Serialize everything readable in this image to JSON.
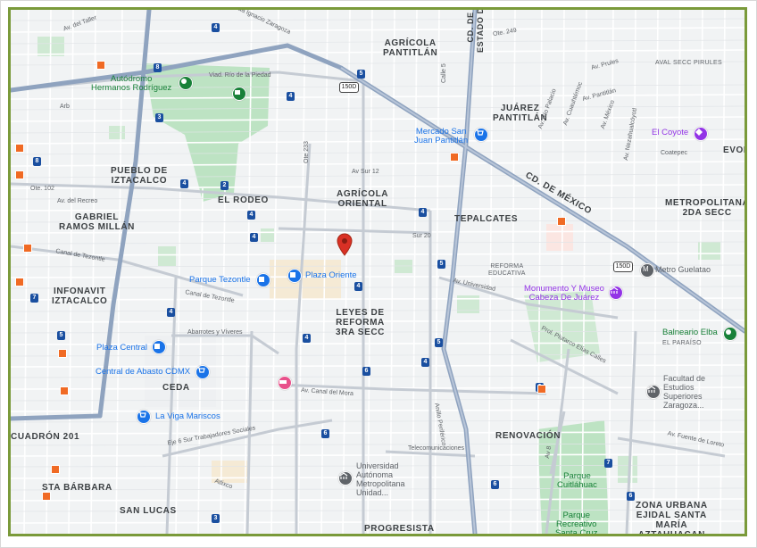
{
  "neighborhoods": {
    "agricola_pantitlan": "AGRÍCOLA\nPANTITLÁN",
    "cd_de_mexico_v": "CD. DE MÉXICO\nESTADO DE MÉXICO",
    "juarez_pantitlan": "JUÁREZ\nPANTITLÁN",
    "evol": "EVOL",
    "pueblo_iztacalco": "PUEBLO DE\nIZTACALCO",
    "el_rodeo": "EL RODEO",
    "agricola_oriental": "AGRÍCOLA\nORIENTAL",
    "tepalcates": "TEPALCATES",
    "cd_de_mexico_d": "CD. DE MÉXICO",
    "metropolitana": "METROPOLITANA\n2DA SECC",
    "gabriel": "GABRIEL\nRAMOS MILLÁN",
    "infonavit": "INFONAVIT\nIZTACALCO",
    "leyes": "LEYES DE\nREFORMA\n3RA SECC",
    "ceda": "CEDA",
    "renovacion": "RENOVACIÓN",
    "cuadron": "CUADRÓN 201",
    "sta_barbara": "STA BÁRBARA",
    "san_lucas": "SAN LUCAS",
    "progresista": "PROGRESISTA",
    "zona_urbana": "ZONA URBANA\nEJIDAL SANTA\nMARÍA\nAZTAHUACAN",
    "aval_secc": "AVAL SECC PIRULES",
    "reforma_educativa": "REFORMA\nEDUCATIVA",
    "el_paraiso": "EL PARAÍSO"
  },
  "streets": {
    "av_del_taller": "Av. del Taller",
    "calz_zaragoza": "Calzada Ignacio Zaragoza",
    "viad_rio_piedad": "Viad. Río de la Piedad",
    "av_sur_12": "Av Sur 12",
    "ote_102": "Ote. 102",
    "av_del_recreo": "Av. del Recreo",
    "canal_tezontle_1": "Canal de Tezontle",
    "canal_tezontle_2": "Canal de Tezontle",
    "sur_20": "Sur 20",
    "av_universidad": "Av. Universidad",
    "abarrotes": "Abarrotes y Víveres",
    "av_canal_mora": "Av. Canal del Mora",
    "anillo_periferico": "Anillo Periférico",
    "telecomunicaciones": "Telecomunicaciones",
    "eje6": "Eje 6 Sur Trabajadores Sociales",
    "ote_233": "Ote 233",
    "calle5": "Calle 5",
    "av_prules": "Av. Prules",
    "av_pantitlan": "Av. Pantitlán",
    "cuauhtemoc": "Av. Cuauhtémoc",
    "av_mexico": "Av. México",
    "av_rio_palacio": "Av. Río Palacio",
    "nezahualcoyotl": "Av. Nezahualcóyotl",
    "coatepec": "Coatepec",
    "ote_249": "Ote. 249",
    "pluterco": "Prol. Plutarco Elías Calles",
    "av_fuente_loreto": "Av. Fuente de Loreto",
    "av8": "Av 8",
    "atlixco": "Atlixco",
    "arb": "Arb"
  },
  "pois": {
    "autodromo": "Autódromo\nHermanos Rodríguez",
    "mercado": "Mercado San\nJuan Pantitlán",
    "el_coyote": "El Coyote",
    "parque_tezontle": "Parque Tezontle",
    "plaza_oriente": "Plaza Oriente",
    "metro_guelatao": "Metro Guelatao",
    "monumento": "Monumento Y Museo\nCabeza De Juárez",
    "balneario": "Balneario Elba",
    "plaza_central": "Plaza Central",
    "central_abasto": "Central de Abasto CDMX",
    "la_viga": "La Viga Mariscos",
    "facultad": "Facultad de\nEstudios\nSuperiores\nZaragoza...",
    "universidad": "Universidad\nAutónoma\nMetropolitana\nUnidad...",
    "parque_cuitlahuac": "Parque\nCuitláhuac",
    "parque_recreativo": "Parque\nRecreativo\nSanta Cruz"
  },
  "shields": [
    "4",
    "5",
    "3",
    "4",
    "4",
    "2",
    "4",
    "4",
    "4",
    "4",
    "4",
    "4",
    "5",
    "4",
    "6",
    "6",
    "6",
    "6",
    "6",
    "7",
    "7",
    "8",
    "8",
    "5",
    "5",
    "3"
  ],
  "highway_shields": [
    "150D",
    "150D"
  ],
  "colors": {
    "border": "#7a9a3a",
    "pin_red": "#d93025",
    "metro_orange": "#f06a24",
    "road_blue": "#8fa3bf"
  },
  "icons": {
    "marker": "red-location-marker-icon",
    "metro": "metro-station-icon",
    "shopping": "shopping-bag-icon",
    "cart": "shopping-cart-icon",
    "museum": "museum-icon",
    "landmark": "landmark-icon",
    "park": "park-icon",
    "hotel": "hotel-icon"
  }
}
